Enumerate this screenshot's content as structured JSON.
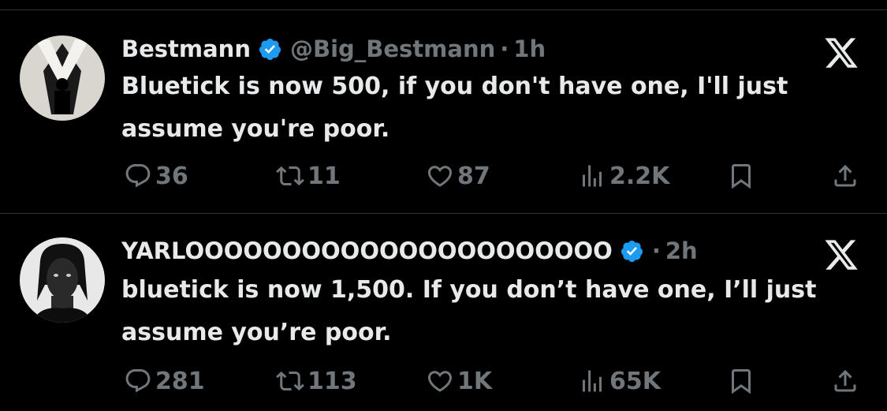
{
  "tweets": [
    {
      "name": "Bestmann",
      "handle": "@Big_Bestmann",
      "separator": "·",
      "time": "1h",
      "text": "Bluetick is now 500, if you don't have one, I'll just\nassume you're poor.",
      "stats": {
        "replies": "36",
        "retweets": "11",
        "likes": "87",
        "views": "2.2K"
      },
      "icons": [
        "reply-icon",
        "retweet-icon",
        "like-icon",
        "views-icon",
        "bookmark-icon",
        "share-icon",
        "x-logo-icon",
        "verified-badge-icon"
      ]
    },
    {
      "name": "YARLOOOOOOOOOOOOOOOOOOOOOO",
      "handle": "",
      "separator": "·",
      "time": "2h",
      "text": "bluetick is now 1,500. If you don’t have one, I’ll just\nassume you’re poor.",
      "stats": {
        "replies": "281",
        "retweets": "113",
        "likes": "1K",
        "views": "65K"
      },
      "icons": [
        "reply-icon",
        "retweet-icon",
        "like-icon",
        "views-icon",
        "bookmark-icon",
        "share-icon",
        "x-logo-icon",
        "verified-badge-icon"
      ]
    }
  ],
  "colors": {
    "background": "#000000",
    "text": "#e7e9ea",
    "muted": "#71767b",
    "verified": "#1d9bf0",
    "divider": "#2f3336"
  }
}
